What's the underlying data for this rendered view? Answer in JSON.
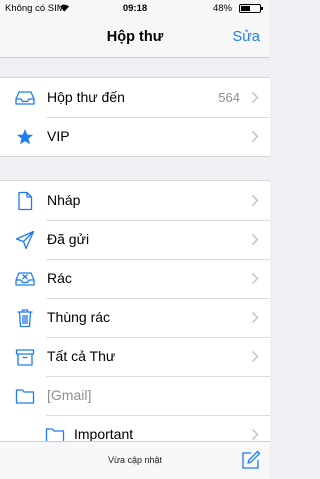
{
  "status_bar": {
    "carrier": "Không có SIM",
    "time": "09:18",
    "battery_percent": "48%",
    "battery_level": 0.48
  },
  "nav": {
    "title": "Hộp thư",
    "edit_label": "Sửa"
  },
  "accent_color": "#1d7cf2",
  "inbox_group": [
    {
      "label": "Hộp thư đến",
      "count": "564",
      "icon": "inbox-tray-icon"
    },
    {
      "label": "VIP",
      "count": "",
      "icon": "star-icon"
    }
  ],
  "folders": [
    {
      "label": "Nháp",
      "icon": "document-icon"
    },
    {
      "label": "Đã gửi",
      "icon": "paper-plane-icon"
    },
    {
      "label": "Rác",
      "icon": "junk-tray-icon"
    },
    {
      "label": "Thùng rác",
      "icon": "trash-can-icon"
    },
    {
      "label": "Tất cả Thư",
      "icon": "archive-box-icon"
    },
    {
      "label": "[Gmail]",
      "icon": "folder-icon"
    },
    {
      "label": "Important",
      "icon": "folder-icon"
    }
  ],
  "toolbar": {
    "updated_label": "Vừa cập nhật",
    "compose_icon": "compose-icon"
  }
}
